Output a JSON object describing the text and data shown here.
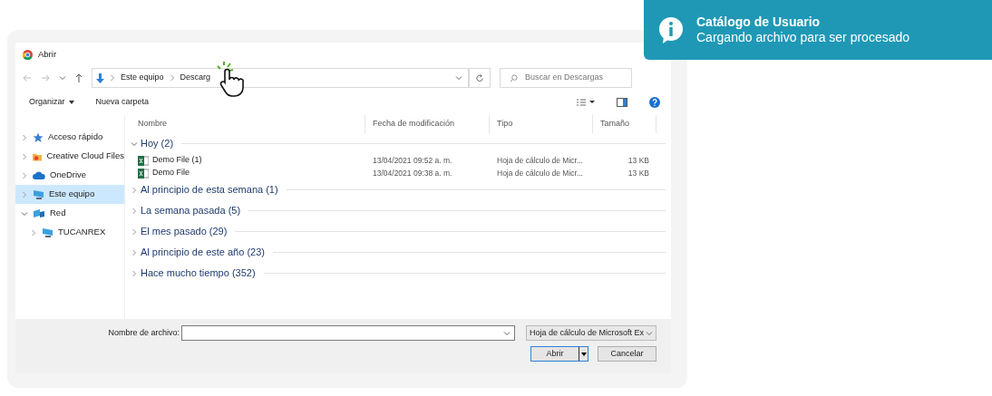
{
  "toast": {
    "title": "Catálogo de Usuario",
    "message": "Cargando archivo para ser procesado"
  },
  "dialog": {
    "title": "Abrir",
    "breadcrumb": [
      "Este equipo",
      "Descarg"
    ],
    "search": {
      "placeholder": "Buscar en Descargas"
    },
    "toolbar": [
      "Organizar",
      "Nueva carpeta"
    ],
    "sidebar": {
      "items": [
        {
          "label": "Acceso rápido",
          "kind": "star",
          "selected": false,
          "expanded": false
        },
        {
          "label": "Creative Cloud Files",
          "kind": "folder",
          "selected": false,
          "expanded": false
        },
        {
          "label": "OneDrive",
          "kind": "cloud",
          "selected": false,
          "expanded": false
        },
        {
          "label": "Este equipo",
          "kind": "pc",
          "selected": true,
          "expanded": false
        },
        {
          "label": "Red",
          "kind": "network",
          "selected": false,
          "expanded": true,
          "children": [
            {
              "label": "TUCANREX",
              "kind": "pc",
              "selected": false,
              "expanded": false
            }
          ]
        }
      ]
    },
    "columns": [
      "Nombre",
      "Fecha de modificación",
      "Tipo",
      "Tamaño"
    ],
    "groups": [
      {
        "label": "Hoy (2)",
        "expanded": true,
        "rows": [
          {
            "name": "Demo File (1)",
            "date": "13/04/2021 09:52 a. m.",
            "type": "Hoja de cálculo de Micr...",
            "size": "13 KB"
          },
          {
            "name": "Demo File",
            "date": "13/04/2021 09:38 a. m.",
            "type": "Hoja de cálculo de Micr...",
            "size": "13 KB"
          }
        ]
      },
      {
        "label": "Al principio de esta semana (1)",
        "expanded": false
      },
      {
        "label": "La semana pasada (5)",
        "expanded": false
      },
      {
        "label": "El mes pasado (29)",
        "expanded": false
      },
      {
        "label": "Al principio de este año (23)",
        "expanded": false
      },
      {
        "label": "Hace mucho tiempo (352)",
        "expanded": false
      }
    ],
    "filename_label": "Nombre de archivo:",
    "filetype": "Hoja de cálculo de Microsoft Ex",
    "buttons": [
      "Abrir",
      "Cancelar"
    ]
  }
}
